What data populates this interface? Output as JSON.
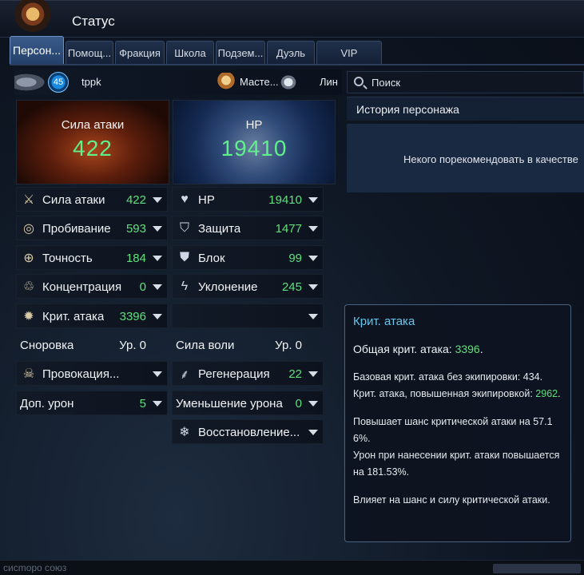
{
  "window": {
    "title": "Статус"
  },
  "tabs": [
    {
      "label": "Персон..."
    },
    {
      "label": "Помощ..."
    },
    {
      "label": "Фракция"
    },
    {
      "label": "Школа"
    },
    {
      "label": "Подзем..."
    },
    {
      "label": "Дуэль"
    },
    {
      "label": "VIP"
    }
  ],
  "character": {
    "level": "45",
    "name": "tppk",
    "class": "Масте...",
    "race": "Лин"
  },
  "hero": {
    "attack": {
      "label": "Сила атаки",
      "value": "422"
    },
    "hp": {
      "label": "HP",
      "value": "19410"
    }
  },
  "left_stats": [
    {
      "icon": "crossed-swords-icon",
      "label": "Сила атаки",
      "value": "422"
    },
    {
      "icon": "piercing-icon",
      "label": "Пробивание",
      "value": "593"
    },
    {
      "icon": "crosshair-icon",
      "label": "Точность",
      "value": "184"
    },
    {
      "icon": "concentration-icon",
      "label": "Концентрация",
      "value": "0"
    },
    {
      "icon": "burst-icon",
      "label": "Крит. атака",
      "value": "3396"
    },
    {
      "icon": "",
      "label": "Сноровка",
      "value": "Ур. 0"
    },
    {
      "icon": "skull-icon",
      "label": "Провокация...",
      "value": ""
    },
    {
      "icon": "",
      "label": "Доп. урон",
      "value": "5"
    }
  ],
  "right_stats": [
    {
      "icon": "heart-icon",
      "label": "HP",
      "value": "19410"
    },
    {
      "icon": "shield-icon",
      "label": "Защита",
      "value": "1477"
    },
    {
      "icon": "block-shield-icon",
      "label": "Блок",
      "value": "99"
    },
    {
      "icon": "lightning-icon",
      "label": "Уклонение",
      "value": "245"
    },
    {
      "icon": "",
      "label": "",
      "value": ""
    },
    {
      "icon": "",
      "label": "Сила воли",
      "value": "Ур. 0"
    },
    {
      "icon": "sprout-icon",
      "label": "Регенерация",
      "value": "22"
    },
    {
      "icon": "",
      "label": "Уменьшение урона",
      "value": "0"
    },
    {
      "icon": "snowflake-icon",
      "label": "Восстановление...",
      "value": ""
    }
  ],
  "search": {
    "placeholder": "Поиск"
  },
  "history": {
    "title": "История персонажа",
    "empty_text": "Некого порекомендовать в качестве"
  },
  "tooltip": {
    "title": "Крит. атака",
    "total_label": "Общая крит. атака: ",
    "total_value": "3396",
    "total_suffix": ".",
    "base_line": "Базовая крит. атака без экипировки: 434.",
    "equip_label": "Крит. атака, повышенная экипировкой: ",
    "equip_value": "2962",
    "equip_suffix": ".",
    "chance_line": "Повышает шанс критической атаки на 57.16%.",
    "damage_line": "Урон при нанесении крит. атаки повышается на 181.53%.",
    "desc_line": "Влияет на шанс и силу критической атаки."
  },
  "bottom": {
    "ghost_text": "сисmоро      союз"
  },
  "colors": {
    "value_green": "#5fe07c",
    "tooltip_title": "#63c6ee",
    "tooltip_yellow": "#f0d25c"
  }
}
